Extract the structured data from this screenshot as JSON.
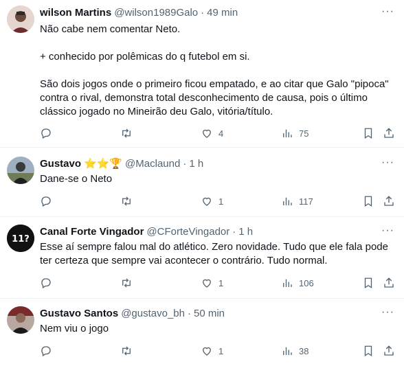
{
  "tweets": [
    {
      "name": "wilson Martins",
      "emojis": "",
      "handle": "@wilson1989Galo",
      "time": "49 min",
      "text": "Não cabe nem comentar Neto.\n\n+ conhecido por polêmicas do q futebol em si.\n\nSão dois jogos onde o primeiro ficou empatado, e ao citar que Galo \"pipoca\" contra o rival, demonstra total desconhecimento de causa, pois o último clássico jogado no Mineirão deu Galo, vitória/título.",
      "replies": "",
      "retweets": "",
      "likes": "4",
      "views": "75"
    },
    {
      "name": "Gustavo",
      "emojis": "⭐⭐🏆",
      "handle": "@Maclaund",
      "time": "1 h",
      "text": "Dane-se o Neto",
      "replies": "",
      "retweets": "",
      "likes": "1",
      "views": "117"
    },
    {
      "name": "Canal Forte Vingador",
      "emojis": "",
      "handle": "@CForteVingador",
      "time": "1 h",
      "text": "Esse aí sempre falou mal do atlético. Zero novidade. Tudo que ele fala pode ter certeza que sempre vai acontecer o contrário. Tudo normal.",
      "replies": "",
      "retweets": "",
      "likes": "1",
      "views": "106"
    },
    {
      "name": "Gustavo Santos",
      "emojis": "",
      "handle": "@gustavo_bh",
      "time": "50 min",
      "text": "Nem viu o jogo",
      "replies": "",
      "retweets": "",
      "likes": "1",
      "views": "38"
    }
  ],
  "icons": {
    "reply": "reply-icon",
    "retweet": "retweet-icon",
    "like": "heart-icon",
    "views": "views-icon",
    "bookmark": "bookmark-icon",
    "share": "share-icon",
    "more": "more-icon"
  },
  "colors": {
    "text": "#0f1419",
    "secondary": "#536471",
    "divider": "#eff3f4"
  }
}
